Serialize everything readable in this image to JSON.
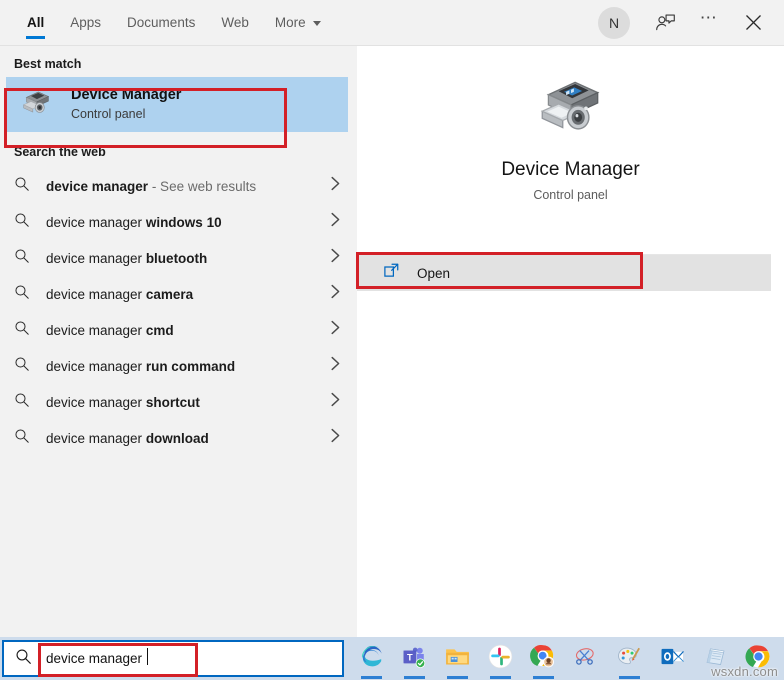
{
  "header": {
    "tabs": [
      {
        "label": "All",
        "active": true
      },
      {
        "label": "Apps",
        "active": false
      },
      {
        "label": "Documents",
        "active": false
      },
      {
        "label": "Web",
        "active": false
      },
      {
        "label": "More",
        "active": false,
        "has_caret": true
      }
    ],
    "avatar_initial": "N",
    "feedback_icon": "person-feedback-icon",
    "more_icon": "ellipsis-icon",
    "close_icon": "close-icon",
    "accent_color": "#0078d4"
  },
  "left": {
    "best_match_title": "Best match",
    "best_match": {
      "title": "Device Manager",
      "subtitle": "Control panel",
      "icon": "device-manager-icon",
      "highlight_color": "#aed2ef"
    },
    "search_web_title": "Search the web",
    "web_results": [
      {
        "query": "device manager",
        "suffix": "",
        "hint": " - See web results",
        "semi": true
      },
      {
        "query": "device manager ",
        "suffix": "windows 10",
        "hint": ""
      },
      {
        "query": "device manager ",
        "suffix": "bluetooth",
        "hint": ""
      },
      {
        "query": "device manager ",
        "suffix": "camera",
        "hint": ""
      },
      {
        "query": "device manager ",
        "suffix": "cmd",
        "hint": ""
      },
      {
        "query": "device manager ",
        "suffix": "run command",
        "hint": ""
      },
      {
        "query": "device manager ",
        "suffix": "shortcut",
        "hint": ""
      },
      {
        "query": "device manager ",
        "suffix": "download",
        "hint": ""
      }
    ]
  },
  "preview": {
    "title": "Device Manager",
    "subtitle": "Control panel",
    "icon": "device-manager-icon",
    "open_label": "Open",
    "open_icon": "open-external-icon"
  },
  "taskbar": {
    "search_value": "device manager",
    "search_icon": "search-icon",
    "search_border_color": "#0067c0",
    "background_color": "#cedcec",
    "items": [
      {
        "name": "edge",
        "label": "Microsoft Edge",
        "running": true
      },
      {
        "name": "teams",
        "label": "Microsoft Teams",
        "running": true
      },
      {
        "name": "file-explorer",
        "label": "File Explorer",
        "running": true
      },
      {
        "name": "slack",
        "label": "Slack",
        "running": true
      },
      {
        "name": "chrome-profile",
        "label": "Google Chrome",
        "running": true
      },
      {
        "name": "snipping-tool",
        "label": "Snipping Tool",
        "running": false
      },
      {
        "name": "paint",
        "label": "Paint",
        "running": true
      },
      {
        "name": "outlook",
        "label": "Outlook",
        "running": false
      },
      {
        "name": "sticky-notes",
        "label": "Notepad",
        "running": false
      },
      {
        "name": "chrome",
        "label": "Google Chrome",
        "running": false
      }
    ]
  },
  "watermark": "wsxdn.com",
  "annotation_color": "#d32027"
}
